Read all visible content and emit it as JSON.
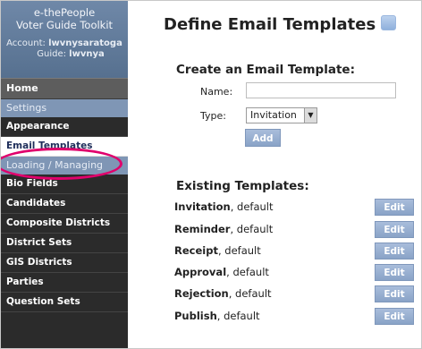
{
  "sidebar": {
    "brand_line1": "e-thePeople",
    "brand_line2": "Voter Guide Toolkit",
    "account_label": "Account:",
    "account_value": "lwvnysaratoga",
    "guide_label": "Guide:",
    "guide_value": "lwvnya",
    "home": "Home",
    "settings_header": "Settings",
    "settings_items": [
      "Appearance",
      "Email Templates"
    ],
    "loading_header": "Loading / Managing",
    "loading_items": [
      "Bio Fields",
      "Candidates",
      "Composite Districts",
      "District Sets",
      "GIS Districts",
      "Parties",
      "Question Sets"
    ]
  },
  "main": {
    "title": "Define Email Templates",
    "create_heading": "Create an Email Template:",
    "name_label": "Name:",
    "name_value": "",
    "type_label": "Type:",
    "type_selected": "Invitation",
    "add_label": "Add",
    "existing_heading": "Existing Templates:",
    "templates": [
      {
        "type": "Invitation",
        "name": ", default",
        "action": "Edit"
      },
      {
        "type": "Reminder",
        "name": ", default",
        "action": "Edit"
      },
      {
        "type": "Receipt",
        "name": ", default",
        "action": "Edit"
      },
      {
        "type": "Approval",
        "name": ", default",
        "action": "Edit"
      },
      {
        "type": "Rejection",
        "name": ", default",
        "action": "Edit"
      },
      {
        "type": "Publish",
        "name": ", default",
        "action": "Edit"
      }
    ]
  },
  "colors": {
    "sidebar_bg": "#2b2b2b",
    "brand_bg": "#6f88a8",
    "section_header": "#7f96b5",
    "highlight_ring": "#e0006c",
    "button_bg": "#98b0d2"
  },
  "icons": {
    "help": "help-icon"
  }
}
